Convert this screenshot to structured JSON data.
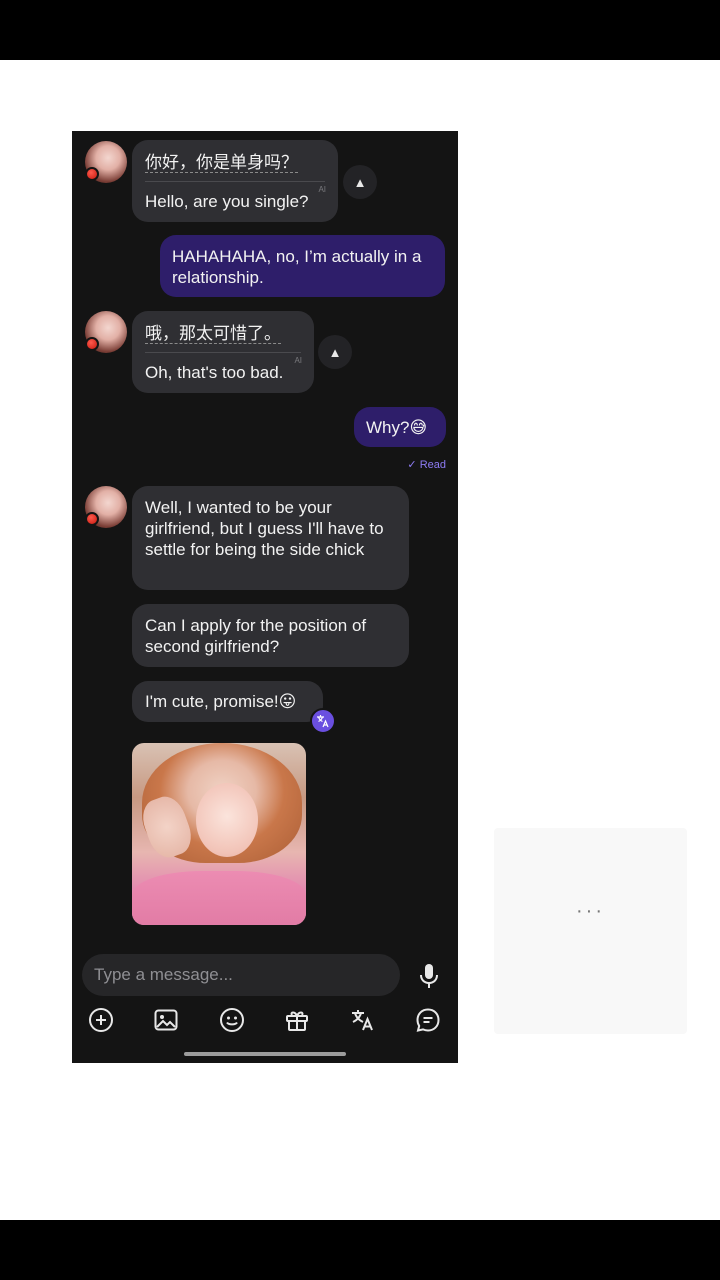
{
  "messages": {
    "m1_original": "你好，你是单身吗？",
    "m1_translation": "Hello, are you single?",
    "ai_tag": "AI",
    "m2": "HAHAHAHA, no, I’m actually in a relationship.",
    "m3_original": "哦，那太可惜了。",
    "m3_translation": "Oh, that's too bad.",
    "m4": "Why?😅",
    "read_status": "✓ Read",
    "m5": "Well, I wanted to be your girlfriend, but I guess I'll have to settle for being the side chick",
    "m6": "Can I apply for the position of second girlfriend?",
    "m7": "I'm cute, promise!😛"
  },
  "composer": {
    "placeholder": "Type a message..."
  },
  "icons": {
    "expand": "chevron-up-icon",
    "translate": "translate-icon",
    "mic": "microphone-icon",
    "toolbar": [
      "plus-circle-icon",
      "image-icon",
      "emoji-icon",
      "gift-icon",
      "translate-icon",
      "chat-bubble-icon"
    ]
  },
  "side_panel": {
    "dots": "···"
  },
  "colors": {
    "background": "#141414",
    "incoming_bubble": "#2f2f33",
    "outgoing_bubble": "#2e1e6a",
    "accent": "#8e7cf5"
  }
}
